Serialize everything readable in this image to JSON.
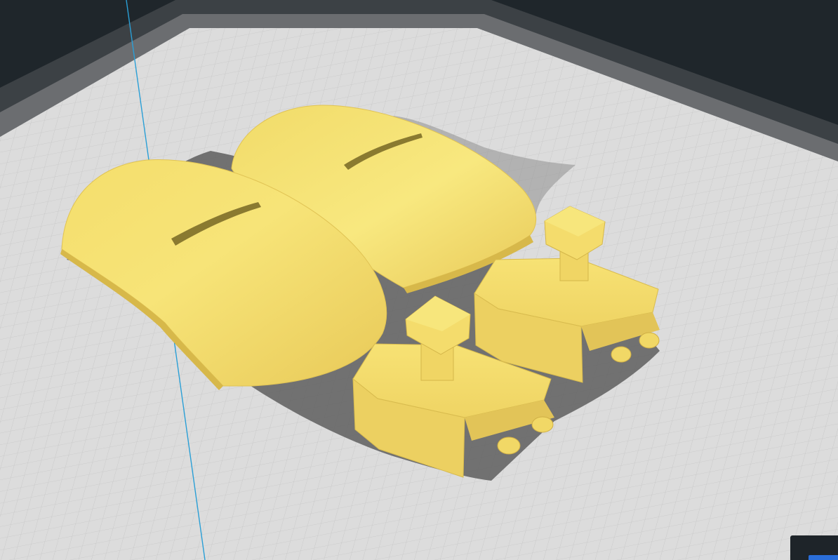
{
  "viewport": {
    "background_color": "#1f262b",
    "build_plate_color": "#d9d9d9",
    "grid_line_color": "#c4c4c4",
    "object_color": "#f5df6e",
    "object_shadow_color": "#5f5f5f",
    "axis_line_color": "#2a9fd6"
  },
  "objects": [
    {
      "name": "left-finger-shell"
    },
    {
      "name": "right-finger-shell"
    },
    {
      "name": "left-hinge-block"
    },
    {
      "name": "right-hinge-block"
    }
  ],
  "corner_widget": {
    "accent_color": "#2a6ed9"
  }
}
